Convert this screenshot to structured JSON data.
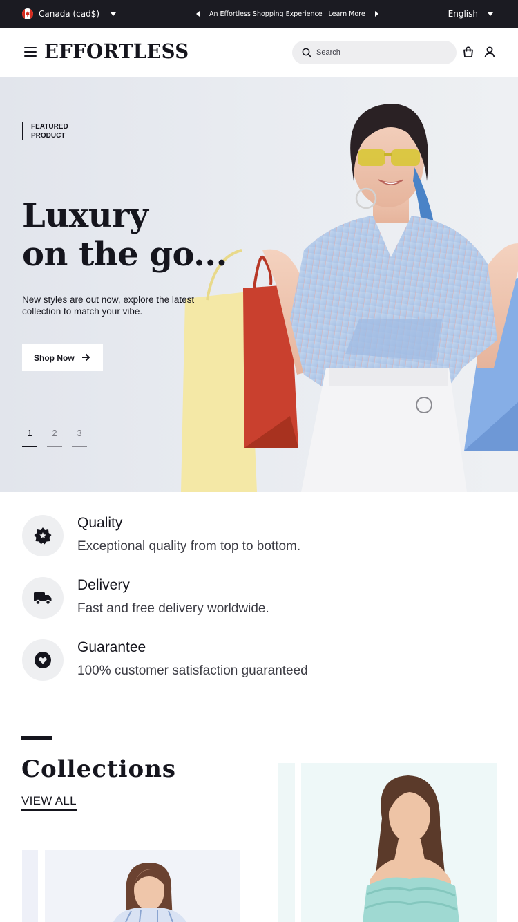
{
  "topbar": {
    "region": "Canada (cad$)",
    "promo_text": "An Effortless Shopping Experience",
    "promo_link": "Learn More",
    "language": "English"
  },
  "header": {
    "logo": "EFFORTLESS",
    "search_placeholder": "Search"
  },
  "hero": {
    "eyebrow_line1": "FEATURED",
    "eyebrow_line2": "PRODUCT",
    "headline_line1": "Luxury",
    "headline_line2": "on the go...",
    "subtitle": "New styles are out now, explore the latest collection to match your vibe.",
    "cta_label": "Shop Now",
    "pages": [
      "1",
      "2",
      "3"
    ],
    "active_page": 1
  },
  "features": [
    {
      "icon": "badge-star-icon",
      "title": "Quality",
      "description": "Exceptional quality from top to bottom."
    },
    {
      "icon": "truck-icon",
      "title": "Delivery",
      "description": "Fast and free delivery worldwide."
    },
    {
      "icon": "heart-shield-icon",
      "title": "Guarantee",
      "description": "100% customer satisfaction guaranteed"
    }
  ],
  "collections": {
    "title": "Collections",
    "view_all": "VIEW ALL"
  },
  "colors": {
    "topbar_bg": "#1b1b22",
    "text_dark": "#15151d",
    "accent_bag_red": "#c9402e",
    "accent_bag_yellow": "#f3e7a4",
    "accent_bag_blue": "#7fa7e2"
  }
}
